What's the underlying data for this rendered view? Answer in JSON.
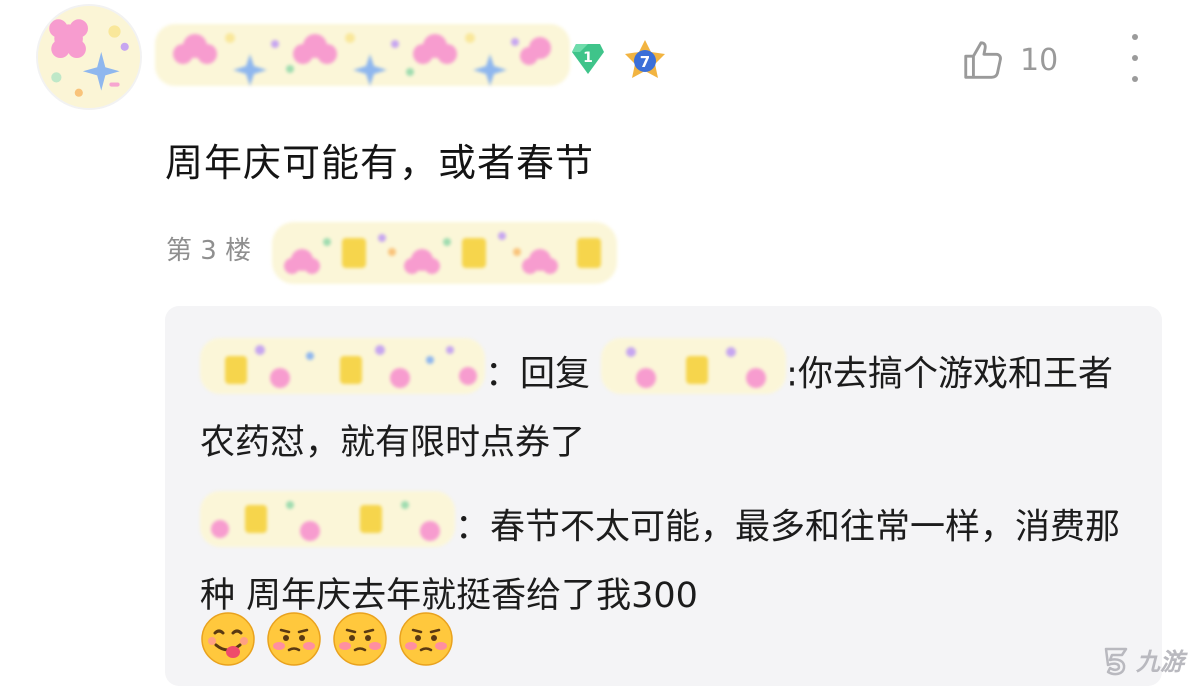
{
  "post": {
    "comment": "周年庆可能有，或者春节",
    "floor_label": "第 3 楼",
    "like_count": "10",
    "level_badge": "1",
    "star_badge": "7"
  },
  "replies": [
    {
      "separator": "：",
      "reply_prefix": "回复",
      "text_after_mention": ":你去搞个游戏和王者农药怼，就有限时点券了"
    },
    {
      "separator": "：",
      "text": "春节不太可能，最多和往常一样，消费那种 周年庆去年就挺香给了我300"
    }
  ],
  "emojis": [
    "yum-emoji",
    "shy-emoji",
    "shy-emoji",
    "shy-emoji"
  ],
  "watermark": {
    "text": "九游"
  },
  "colors": {
    "reply_bg": "#f4f4f6",
    "muted": "#8f8f8f",
    "level_badge": "#3fc48a",
    "star_badge": "#3b6fd8"
  }
}
